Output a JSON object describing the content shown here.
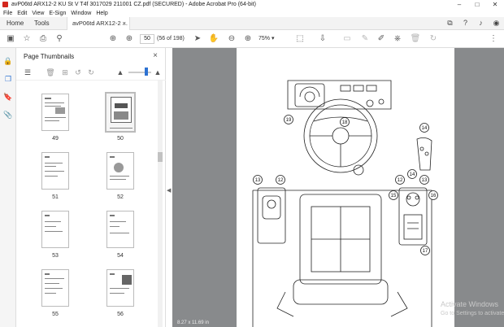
{
  "window": {
    "title": "avP06td ARX12-2 KU St V T4f 3017029 211001 CZ.pdf (SECURED) - Adobe Acrobat Pro (64-bit)",
    "controls": [
      "–",
      "□",
      "✕"
    ]
  },
  "menu": [
    "File",
    "Edit",
    "View",
    "E-Sign",
    "Window",
    "Help"
  ],
  "tabs": {
    "home": "Home",
    "tools": "Tools",
    "document": "avP06td ARX12-2 ...",
    "document_close": "×"
  },
  "toolbar": {
    "current_page": "50",
    "page_of": "(56 of 198)",
    "zoom": "75%"
  },
  "thumbnails": {
    "title": "Page Thumbnails",
    "close": "×",
    "pages": [
      {
        "label": "49"
      },
      {
        "label": "50"
      },
      {
        "label": "51"
      },
      {
        "label": "52"
      },
      {
        "label": "53"
      },
      {
        "label": "54"
      },
      {
        "label": "55"
      },
      {
        "label": "56"
      }
    ]
  },
  "document": {
    "page_size": "8.27 x 11.69 in",
    "callouts": [
      "19",
      "18",
      "14",
      "13",
      "12",
      "12",
      "14",
      "13",
      "15",
      "16",
      "17"
    ]
  },
  "watermark": {
    "line1": "Activate Windows",
    "line2": "Go to Settings to activate"
  },
  "colors": {
    "accent": "#2d72d2",
    "acrobat_red": "#d4271d",
    "doc_background": "#888a8c"
  }
}
